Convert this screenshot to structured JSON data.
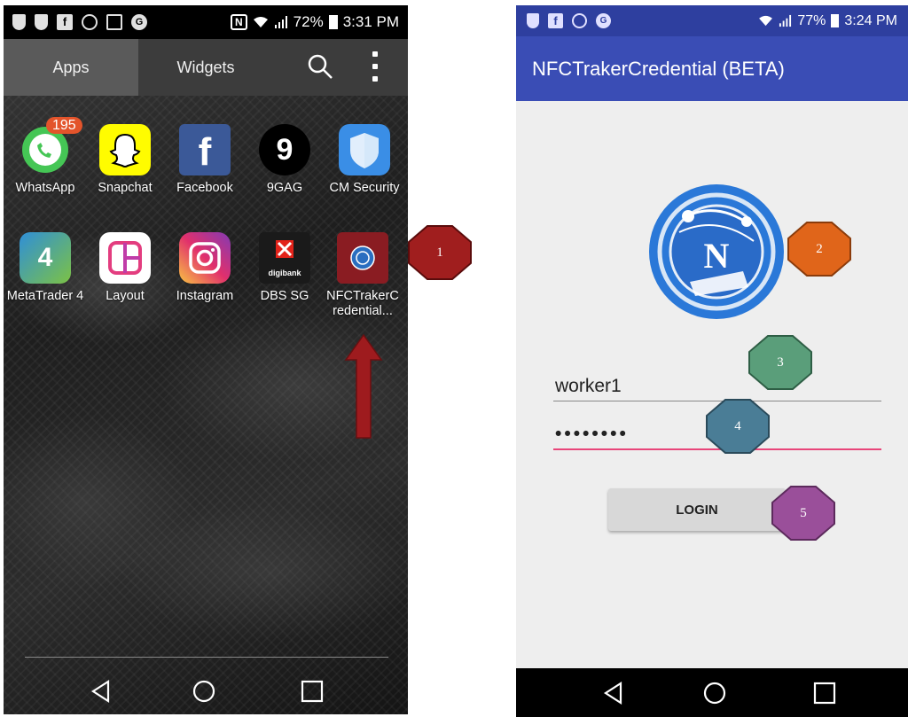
{
  "left_screen": {
    "status_bar": {
      "battery": "72%",
      "time": "3:31 PM",
      "nfc_icon": "N"
    },
    "tabs": [
      {
        "label": "Apps",
        "active": true
      },
      {
        "label": "Widgets",
        "active": false
      }
    ],
    "apps": [
      {
        "label": "WhatsApp",
        "badge": "195",
        "icon": "whatsapp-icon"
      },
      {
        "label": "Snapchat",
        "icon": "snapchat-icon"
      },
      {
        "label": "Facebook",
        "icon": "facebook-icon",
        "glyph": "f"
      },
      {
        "label": "9GAG",
        "icon": "9gag-icon",
        "glyph": "9"
      },
      {
        "label": "CM Security",
        "icon": "cm-security-icon"
      },
      {
        "label": "MetaTrader 4",
        "icon": "metatrader-icon",
        "glyph": "4"
      },
      {
        "label": "Layout",
        "icon": "layout-icon"
      },
      {
        "label": "Instagram",
        "icon": "instagram-icon"
      },
      {
        "label": "DBS SG",
        "icon": "dbs-icon",
        "subtext": "digibank"
      },
      {
        "label": "NFCTrakerCredential...",
        "icon": "nfctraker-icon"
      }
    ]
  },
  "right_screen": {
    "status_bar": {
      "battery": "77%",
      "time": "3:24 PM"
    },
    "app_title": "NFCTrakerCredential (BETA)",
    "logo_letter": "N",
    "username_value": "worker1",
    "password_value": "••••••••",
    "login_label": "LOGIN"
  },
  "annotations": [
    {
      "number": "1",
      "color": "#a01e1e"
    },
    {
      "number": "2",
      "color": "#e0651a"
    },
    {
      "number": "3",
      "color": "#5a9e7a"
    },
    {
      "number": "4",
      "color": "#4a7d96"
    },
    {
      "number": "5",
      "color": "#9a4f9a"
    }
  ]
}
